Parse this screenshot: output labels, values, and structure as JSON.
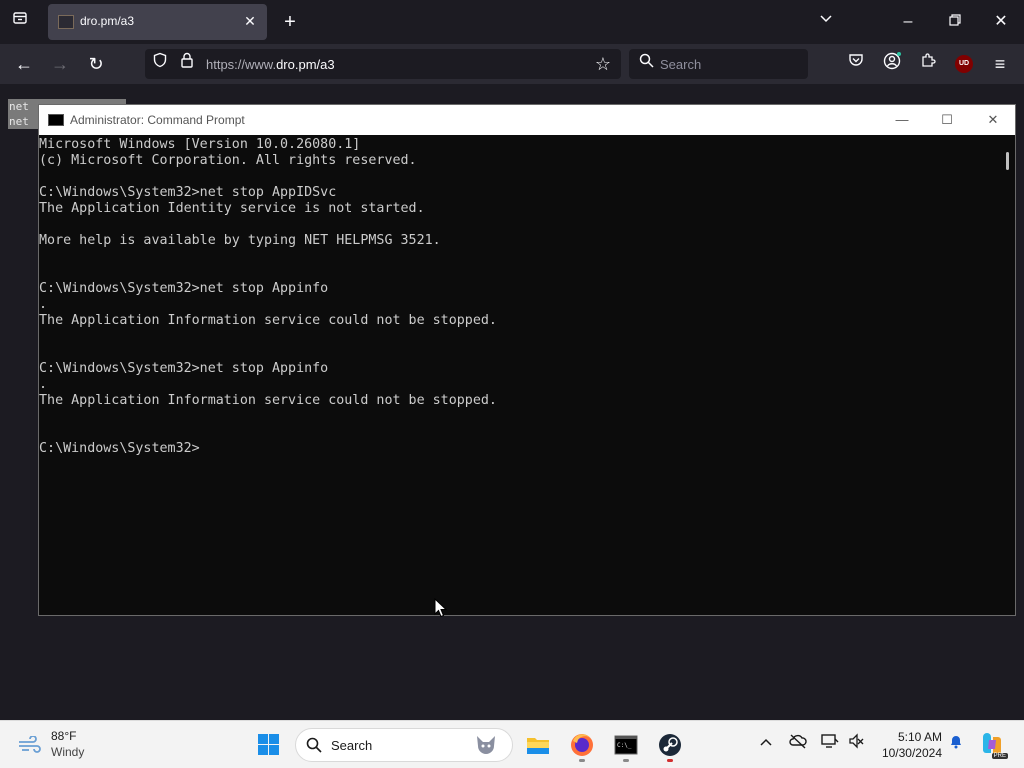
{
  "browser": {
    "tab_title": "dro.pm/a3",
    "url_prefix": "https://www.",
    "url_domain": "dro.pm/a3",
    "search_placeholder": "Search",
    "addon_badge": "UD"
  },
  "background_text": {
    "lines": [
      "net ",
      "net "
    ]
  },
  "cmd": {
    "title": "Administrator: Command Prompt",
    "lines": [
      "Microsoft Windows [Version 10.0.26080.1]",
      "(c) Microsoft Corporation. All rights reserved.",
      "",
      "C:\\Windows\\System32>net stop AppIDSvc",
      "The Application Identity service is not started.",
      "",
      "More help is available by typing NET HELPMSG 3521.",
      "",
      "",
      "C:\\Windows\\System32>net stop Appinfo",
      ".",
      "The Application Information service could not be stopped.",
      "",
      "",
      "C:\\Windows\\System32>net stop Appinfo",
      ".",
      "The Application Information service could not be stopped.",
      "",
      "",
      "C:\\Windows\\System32>"
    ]
  },
  "taskbar": {
    "weather_temp": "88°F",
    "weather_cond": "Windy",
    "search_placeholder": "Search",
    "time": "5:10 AM",
    "date": "10/30/2024",
    "copilot_badge": "PRE"
  },
  "colors": {
    "console_bg": "#0c0c0c",
    "console_fg": "#cccccc",
    "browser_bg": "#1c1b22",
    "toolbar_bg": "#2b2a33",
    "accent_blue": "#1a8ee8"
  }
}
